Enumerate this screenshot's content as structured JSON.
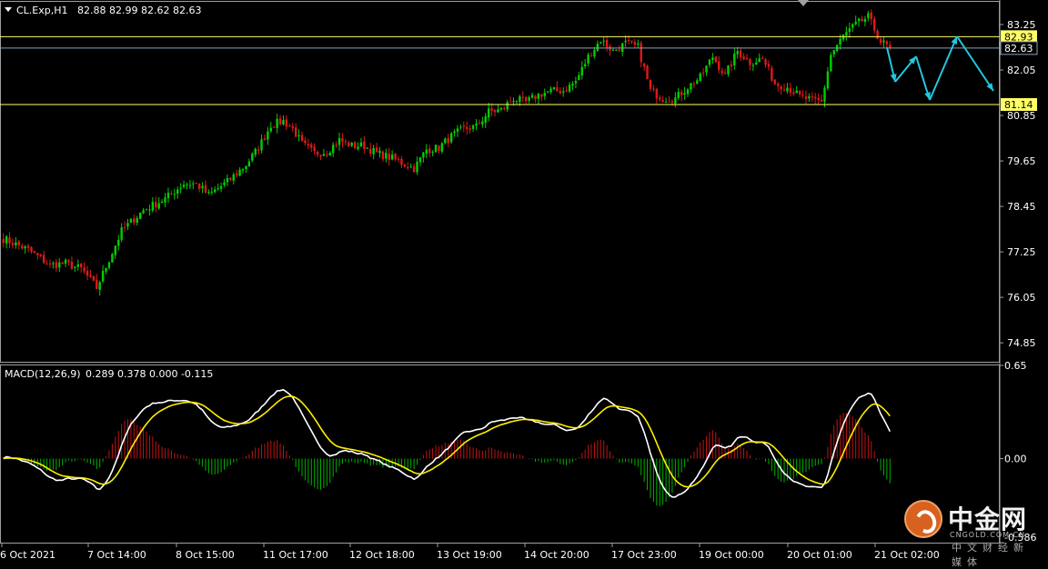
{
  "header": {
    "symbol_label": "CL.Exp,H1",
    "ohlc_label": "82.88 82.99 82.62 82.63"
  },
  "macd_header": {
    "label": "MACD(12,26,9)",
    "values_label": "0.289 0.378 0.000 -0.115"
  },
  "colors": {
    "background": "#000000",
    "bull": "#00d000",
    "bear": "#e01818",
    "macd_line": "#ffffff",
    "signal_line": "#ffee00",
    "level_line": "#ffff66",
    "current_line": "#8ea0b8",
    "arrow": "#22c8e0",
    "axis_text": "#ffffff",
    "frame": "#a0a0a0"
  },
  "watermark": {
    "brand": "中金网",
    "domain": "CNGOLD.COM.CN",
    "tagline": "中文财经新媒体"
  },
  "chart_data": [
    {
      "type": "candlestick",
      "title": "CL.Exp,H1",
      "ylim": [
        74.35,
        83.85
      ],
      "y_ticks": [
        "83.25",
        "82.05",
        "80.85",
        "79.65",
        "78.45",
        "77.25",
        "76.05",
        "74.85"
      ],
      "x_ticks": [
        "6 Oct 2021",
        "7 Oct 14:00",
        "8 Oct 15:00",
        "11 Oct 17:00",
        "12 Oct 18:00",
        "13 Oct 19:00",
        "14 Oct 20:00",
        "17 Oct 23:00",
        "19 Oct 00:00",
        "20 Oct 01:00",
        "21 Oct 02:00"
      ],
      "last_price": "82.63",
      "levels": [
        {
          "label": "82.93",
          "value": 82.93
        },
        {
          "label": "81.14",
          "value": 81.14
        }
      ],
      "close_anchors": [
        [
          0,
          77.6
        ],
        [
          8,
          77.3
        ],
        [
          15,
          76.9
        ],
        [
          20,
          76.95
        ],
        [
          25,
          76.8
        ],
        [
          30,
          76.3
        ],
        [
          38,
          77.8
        ],
        [
          45,
          78.35
        ],
        [
          52,
          78.65
        ],
        [
          58,
          79.05
        ],
        [
          62,
          79.05
        ],
        [
          66,
          78.75
        ],
        [
          72,
          79.1
        ],
        [
          78,
          79.55
        ],
        [
          82,
          80.0
        ],
        [
          86,
          80.6
        ],
        [
          90,
          80.7
        ],
        [
          93,
          80.5
        ],
        [
          96,
          80.1
        ],
        [
          100,
          79.85
        ],
        [
          104,
          79.9
        ],
        [
          108,
          80.2
        ],
        [
          112,
          80.05
        ],
        [
          116,
          80.05
        ],
        [
          120,
          79.85
        ],
        [
          124,
          79.75
        ],
        [
          128,
          79.6
        ],
        [
          132,
          79.45
        ],
        [
          136,
          79.95
        ],
        [
          140,
          80.0
        ],
        [
          144,
          80.3
        ],
        [
          148,
          80.5
        ],
        [
          152,
          80.55
        ],
        [
          156,
          80.95
        ],
        [
          160,
          81.0
        ],
        [
          164,
          81.3
        ],
        [
          168,
          81.2
        ],
        [
          172,
          81.4
        ],
        [
          176,
          81.5
        ],
        [
          180,
          81.5
        ],
        [
          184,
          81.75
        ],
        [
          188,
          82.4
        ],
        [
          192,
          82.85
        ],
        [
          196,
          82.55
        ],
        [
          200,
          82.75
        ],
        [
          204,
          82.65
        ],
        [
          208,
          81.5
        ],
        [
          212,
          81.3
        ],
        [
          216,
          81.3
        ],
        [
          220,
          81.6
        ],
        [
          224,
          81.85
        ],
        [
          228,
          82.4
        ],
        [
          232,
          81.9
        ],
        [
          236,
          82.55
        ],
        [
          240,
          82.25
        ],
        [
          244,
          82.35
        ],
        [
          248,
          81.7
        ],
        [
          252,
          81.6
        ],
        [
          256,
          81.35
        ],
        [
          260,
          81.25
        ],
        [
          263,
          81.2
        ],
        [
          266,
          82.45
        ],
        [
          270,
          82.95
        ],
        [
          274,
          83.25
        ],
        [
          278,
          83.45
        ],
        [
          282,
          82.8
        ],
        [
          285,
          82.63
        ]
      ],
      "forecast_arrows": [
        [
          [
            975,
            52
          ],
          [
            984,
            90
          ]
        ],
        [
          [
            984,
            90
          ],
          [
            1007,
            62
          ]
        ],
        [
          [
            1007,
            62
          ],
          [
            1022,
            110
          ]
        ],
        [
          [
            1022,
            110
          ],
          [
            1052,
            40
          ]
        ],
        [
          [
            1052,
            40
          ],
          [
            1092,
            100
          ]
        ]
      ]
    },
    {
      "type": "macd",
      "title": "MACD(12,26,9)",
      "ylim": [
        -0.586,
        0.65
      ],
      "y_ticks": [
        "0.65",
        "0.00",
        "-0.586"
      ],
      "params": [
        12,
        26,
        9
      ],
      "values": [
        0.289,
        0.378,
        0.0,
        -0.115
      ]
    }
  ]
}
